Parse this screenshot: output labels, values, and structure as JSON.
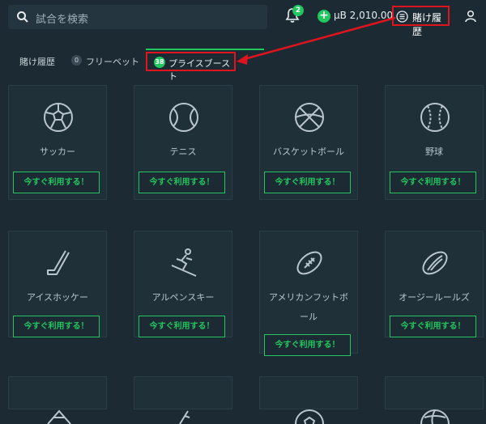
{
  "header": {
    "search_placeholder": "試合を検索",
    "notification_count": "2",
    "balance": "µB 2,010.00",
    "bet_history_label": "賭け履歴"
  },
  "tabs": [
    {
      "label": "賭け履歴",
      "active": false
    },
    {
      "label": "フリーベット",
      "count": "0",
      "active": false
    },
    {
      "label": "プライスブースト",
      "count": "38",
      "active": true
    }
  ],
  "cards": [
    {
      "name": "サッカー",
      "button": "今すぐ利用する！",
      "icon": "soccer-ball-icon"
    },
    {
      "name": "テニス",
      "button": "今すぐ利用する！",
      "icon": "tennis-ball-icon"
    },
    {
      "name": "バスケットボール",
      "button": "今すぐ利用する！",
      "icon": "basketball-icon"
    },
    {
      "name": "野球",
      "button": "今すぐ利用する！",
      "icon": "baseball-icon"
    },
    {
      "name": "アイスホッケー",
      "button": "今すぐ利用する！",
      "icon": "hockey-stick-icon"
    },
    {
      "name": "アルペンスキー",
      "button": "今すぐ利用する！",
      "icon": "skier-icon"
    },
    {
      "name": "アメリカンフットボ",
      "name2": "ール",
      "button": "今すぐ利用する！",
      "icon": "american-football-icon"
    },
    {
      "name": "オージールールズ",
      "button": "今すぐ利用する！",
      "icon": "aussie-rules-ball-icon"
    }
  ],
  "colors": {
    "accent": "#22c55e",
    "highlight": "#e0141e",
    "background": "#1b2a33"
  }
}
